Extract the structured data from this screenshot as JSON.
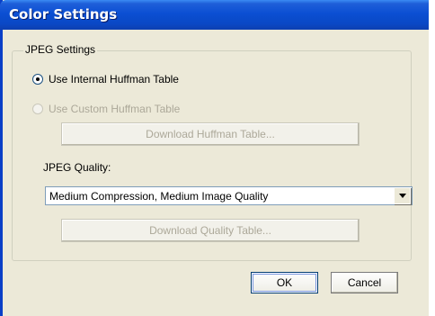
{
  "window": {
    "title": "Color Settings"
  },
  "group": {
    "label": "JPEG Settings"
  },
  "huffman": {
    "internal_label": "Use Internal Huffman Table",
    "internal_checked": true,
    "custom_label": "Use Custom Huffman Table",
    "custom_enabled": false,
    "download_button": "Download Huffman Table..."
  },
  "quality": {
    "label": "JPEG Quality:",
    "selected": "Medium Compression, Medium Image Quality",
    "dropdown_icon": "chevron-down-icon",
    "download_button": "Download Quality Table..."
  },
  "actions": {
    "ok": "OK",
    "cancel": "Cancel"
  }
}
